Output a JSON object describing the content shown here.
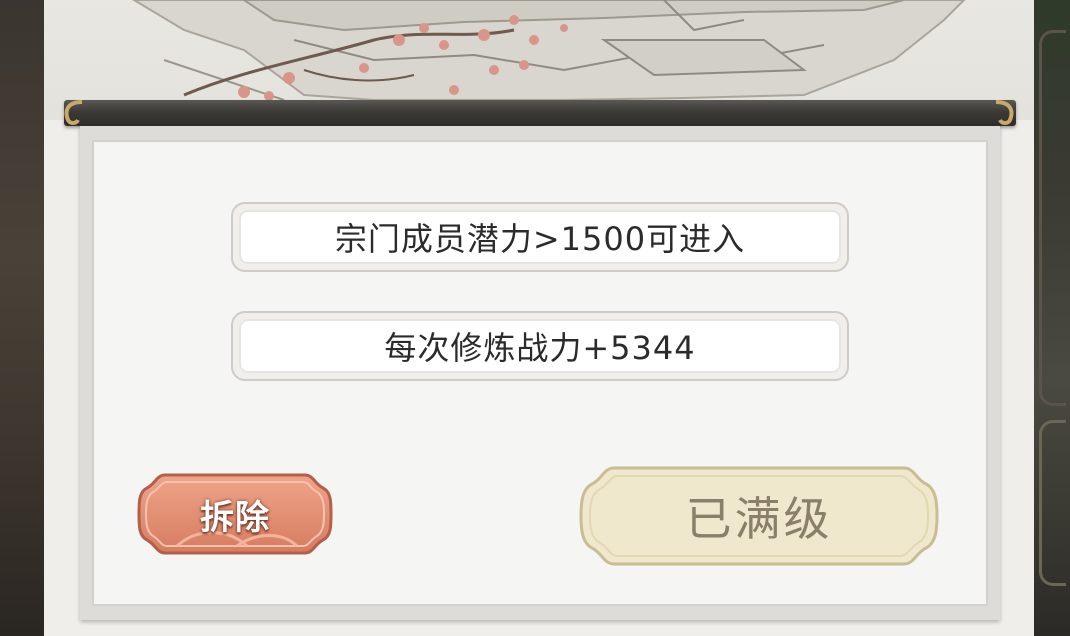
{
  "info": {
    "requirement": "宗门成员潜力>1500可进入",
    "bonus": "每次修炼战力+5344"
  },
  "buttons": {
    "demolish_label": "拆除",
    "max_level_label": "已满级"
  },
  "colors": {
    "demolish_button": "#e08f73",
    "max_level_button": "#efe8cc",
    "scroll_rod": "#3c3a37"
  }
}
